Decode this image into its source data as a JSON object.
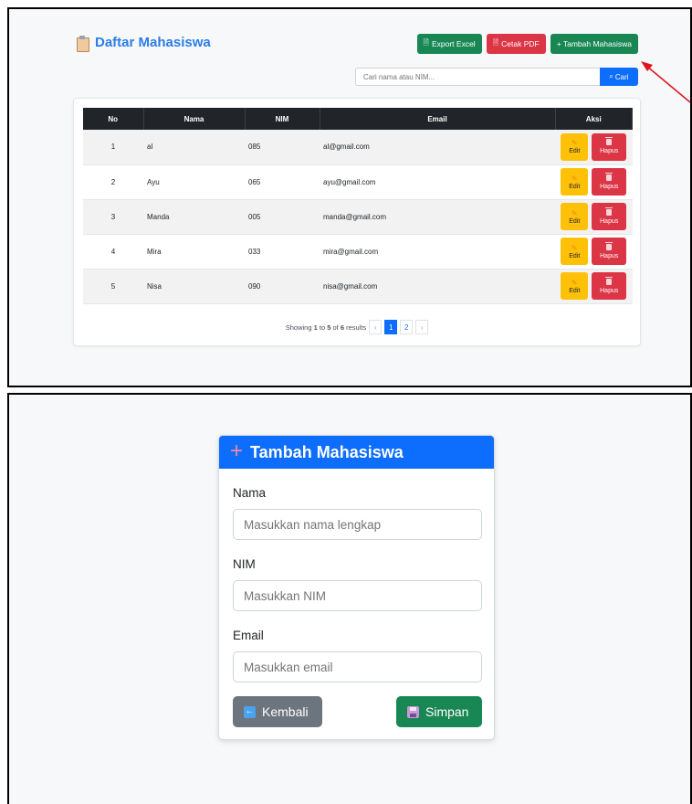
{
  "list_page": {
    "title": "Daftar Mahasiswa",
    "toolbar": {
      "export_excel": "Export Excel",
      "cetak_pdf": "Cetak PDF",
      "tambah": "+ Tambah Mahasiswa"
    },
    "search": {
      "placeholder": "Cari nama atau NIM...",
      "button": "Cari"
    },
    "table": {
      "headers": [
        "No",
        "Nama",
        "NIM",
        "Email",
        "Aksi"
      ],
      "rows": [
        {
          "no": "1",
          "nama": "al",
          "nim": "085",
          "email": "al@gmail.com"
        },
        {
          "no": "2",
          "nama": "Ayu",
          "nim": "065",
          "email": "ayu@gmail.com"
        },
        {
          "no": "3",
          "nama": "Manda",
          "nim": "005",
          "email": "manda@gmail.com"
        },
        {
          "no": "4",
          "nama": "Mira",
          "nim": "033",
          "email": "mira@gmail.com"
        },
        {
          "no": "5",
          "nama": "Nisa",
          "nim": "090",
          "email": "nisa@gmail.com"
        }
      ],
      "edit_label": "Edit",
      "delete_label": "Hapus"
    },
    "pagination": {
      "text_prefix": "Showing",
      "from": "1",
      "to_word": "to",
      "to": "5",
      "of_word": "of",
      "total": "6",
      "results_word": "results",
      "prev": "‹",
      "pages": [
        "1",
        "2"
      ],
      "next": "›"
    }
  },
  "form_page": {
    "title": "Tambah Mahasiswa",
    "fields": {
      "nama": {
        "label": "Nama",
        "placeholder": "Masukkan nama lengkap"
      },
      "nim": {
        "label": "NIM",
        "placeholder": "Masukkan NIM"
      },
      "email": {
        "label": "Email",
        "placeholder": "Masukkan email"
      }
    },
    "back_button": "Kembali",
    "save_button": "Simpan"
  },
  "colors": {
    "primary": "#0d6efd",
    "success": "#198754",
    "danger": "#dc3545",
    "warning": "#ffc107",
    "secondary": "#6c757d",
    "annotation_arrow": "#e0141e"
  }
}
